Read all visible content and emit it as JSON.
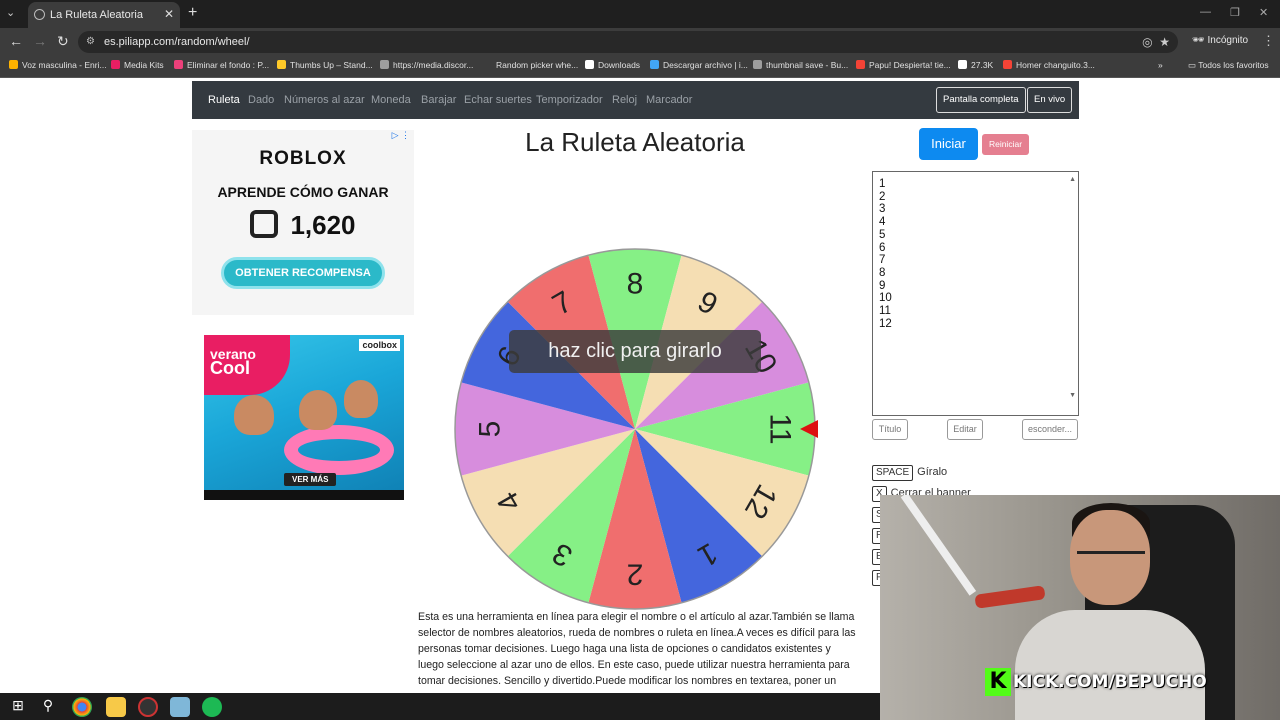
{
  "browser": {
    "tab_title": "La Ruleta Aleatoria",
    "url": "es.piliapp.com/random/wheel/",
    "profile": "Incógnito",
    "bookmarks": [
      {
        "label": "Voz masculina - Enri...",
        "color": "#ffb300"
      },
      {
        "label": "Media Kits",
        "color": "#e91e63"
      },
      {
        "label": "Eliminar el fondo : P...",
        "color": "#ec407a"
      },
      {
        "label": "Thumbs Up – Stand...",
        "color": "#ffca28"
      },
      {
        "label": "https://media.discor...",
        "color": "#9e9e9e"
      },
      {
        "label": "Random picker whe...",
        "color": "#3c3c3c"
      },
      {
        "label": "Downloads",
        "color": "#ffffff"
      },
      {
        "label": "Descargar archivo | i...",
        "color": "#42a5f5"
      },
      {
        "label": "thumbnail save - Bu...",
        "color": "#9e9e9e"
      },
      {
        "label": "Papu! Despierta! tie...",
        "color": "#f44336"
      },
      {
        "label": "27.3K",
        "color": "#ffffff"
      },
      {
        "label": "Homer changuito.3...",
        "color": "#f44336"
      }
    ],
    "bookmarks_folder": "Todos los favoritos"
  },
  "nav": {
    "links": [
      "Ruleta",
      "Dado",
      "Números al azar",
      "Moneda",
      "Barajar",
      "Echar suertes",
      "Temporizador",
      "Reloj",
      "Marcador"
    ],
    "fullscreen": "Pantalla completa",
    "live": "En vivo"
  },
  "ads": {
    "roblox": {
      "logo": "ROBLOX",
      "headline": "APRENDE CÓMO GANAR",
      "amount": "1,620",
      "button": "OBTENER RECOMPENSA"
    },
    "summer": {
      "badge_line1": "verano",
      "badge_line2": "Cool",
      "brand": "coolbox",
      "button": "VER MÁS"
    }
  },
  "page": {
    "title": "La Ruleta Aleatoria",
    "spin_hint": "haz clic para girarlo",
    "start": "Iniciar",
    "reset": "Reiniciar",
    "title_btn": "Título",
    "edit_btn": "Editar",
    "hide_btn": "esconder...",
    "description": "Esta es una herramienta en línea para elegir el nombre o el artículo al azar.También se llama selector de nombres aleatorios, rueda de nombres o ruleta en línea.A veces es difícil para las personas tomar decisiones. Luego haga una lista de opciones o candidatos existentes y luego seleccione al azar uno de ellos. En este caso, puede utilizar nuestra herramienta para tomar decisiones. Sencillo y divertido.Puede modificar los nombres en textarea, poner un"
  },
  "options_list": [
    "1",
    "2",
    "3",
    "4",
    "5",
    "6",
    "7",
    "8",
    "9",
    "10",
    "11",
    "12"
  ],
  "shortcuts": [
    {
      "key": "SPACE",
      "label": "Gíralo"
    },
    {
      "key": "X",
      "label": "Cerrar el banner"
    },
    {
      "key": "S",
      "label": ""
    },
    {
      "key": "R",
      "label": ""
    },
    {
      "key": "E",
      "label": ""
    },
    {
      "key": "F",
      "label": ""
    }
  ],
  "wheel": {
    "segments": [
      {
        "label": "1",
        "color": "#4466dd"
      },
      {
        "label": "2",
        "color": "#f06e6e"
      },
      {
        "label": "3",
        "color": "#86f086"
      },
      {
        "label": "4",
        "color": "#f5deb3"
      },
      {
        "label": "5",
        "color": "#d78ddd"
      },
      {
        "label": "6",
        "color": "#4466dd"
      },
      {
        "label": "7",
        "color": "#f06e6e"
      },
      {
        "label": "8",
        "color": "#86f086"
      },
      {
        "label": "9",
        "color": "#f5deb3"
      },
      {
        "label": "10",
        "color": "#d78ddd"
      },
      {
        "label": "11",
        "color": "#86f086"
      },
      {
        "label": "12",
        "color": "#f5deb3"
      }
    ],
    "pointer_color": "#dd1111"
  },
  "stream": {
    "overlay": "KICK.COM/BEPUCHO"
  }
}
